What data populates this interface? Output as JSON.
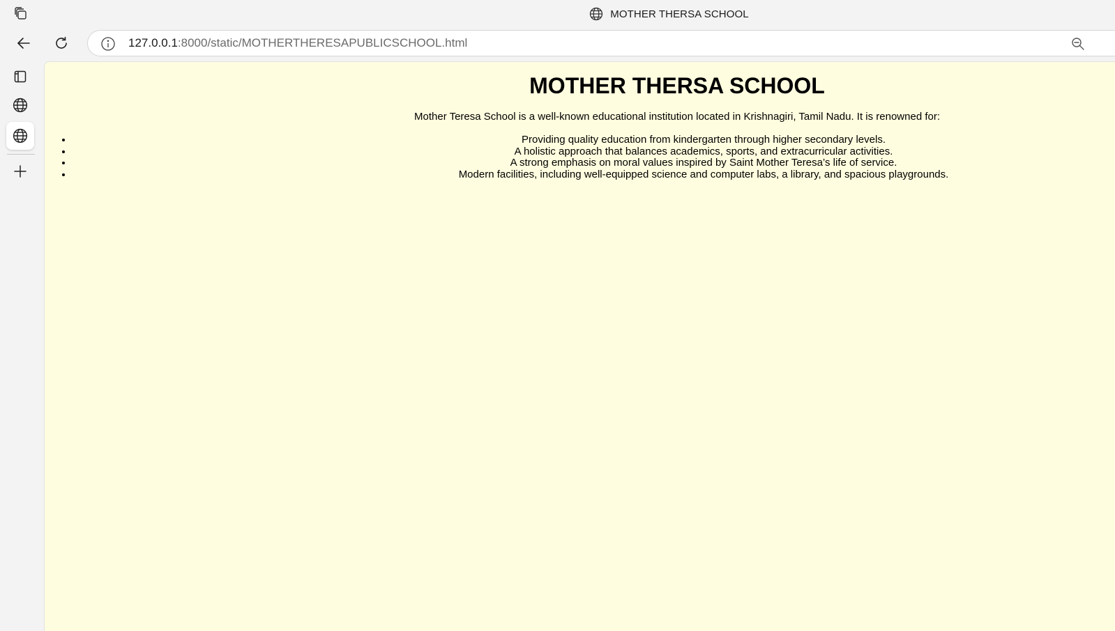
{
  "browser": {
    "tab_title": "MOTHER THERSA SCHOOL",
    "url_host": "127.0.0.1",
    "url_path": ":8000/static/MOTHERTHERESAPUBLICSCHOOL.html",
    "icons": {
      "app": "tab-actions-icon",
      "tab_favicon": "globe-icon",
      "back": "back-arrow-icon",
      "reload": "reload-icon",
      "site_info": "info-icon",
      "zoom": "zoom-out-icon",
      "sidebar_tabs": "tabs-icon",
      "sidebar_new_tab": "plus-icon"
    }
  },
  "page": {
    "heading": "MOTHER THERSA SCHOOL",
    "intro": "Mother Teresa School is a well-known educational institution located in Krishnagiri, Tamil Nadu. It is renowned for:",
    "features": [
      "Providing quality education from kindergarten through higher secondary levels.",
      "A holistic approach that balances academics, sports, and extracurricular activities.",
      "A strong emphasis on moral values inspired by Saint Mother Teresa’s life of service.",
      "Modern facilities, including well-equipped science and computer labs, a library, and spacious playgrounds."
    ],
    "background_color": "#fffddf"
  }
}
